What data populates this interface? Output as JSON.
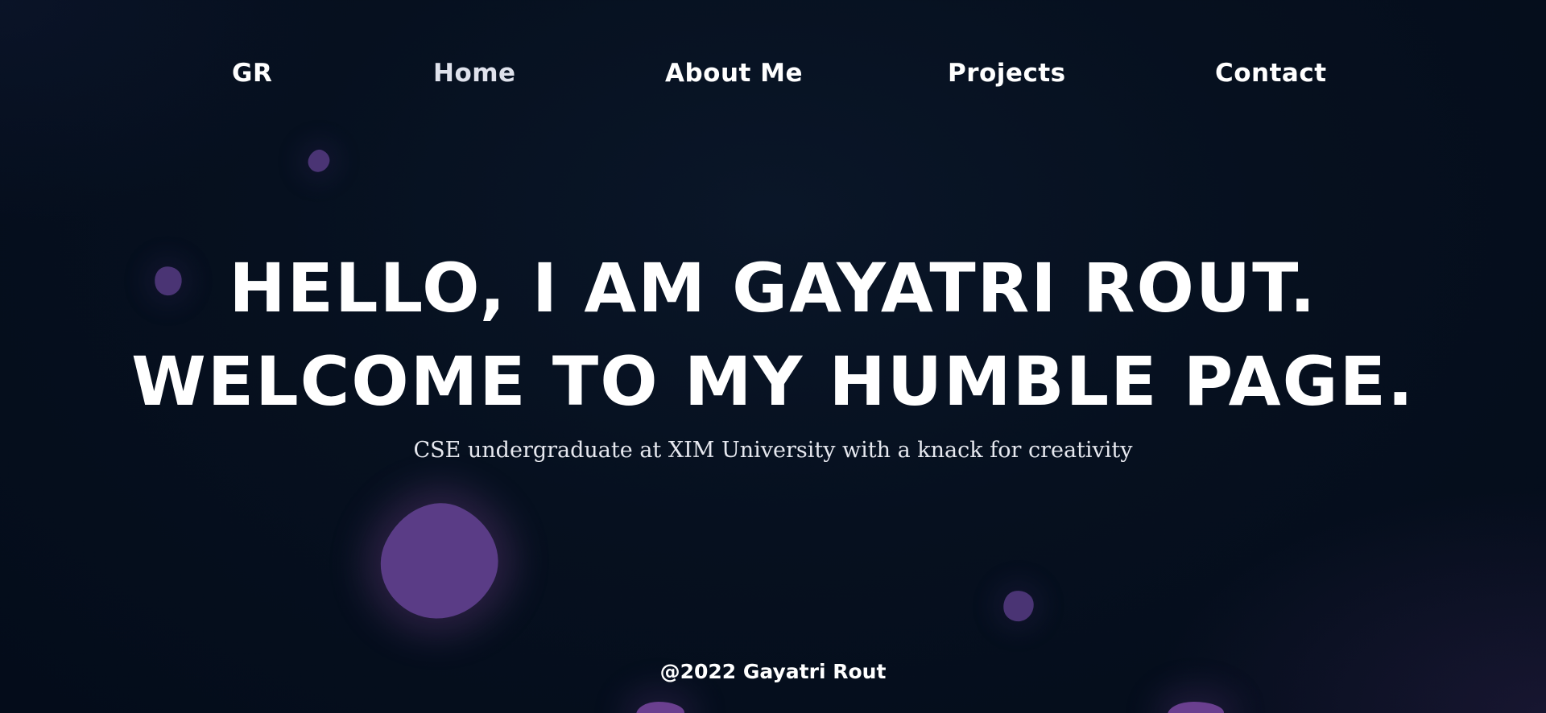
{
  "nav": {
    "logo": "GR",
    "items": [
      {
        "label": "Home"
      },
      {
        "label": "About Me"
      },
      {
        "label": "Projects"
      },
      {
        "label": "Contact"
      }
    ]
  },
  "hero": {
    "title_line_1": "HELLO, I AM GAYATRI ROUT.",
    "title_line_2": "WELCOME TO MY HUMBLE PAGE.",
    "subtitle": "CSE undergraduate at XIM University with a knack for creativity"
  },
  "footer": {
    "copyright": "@2022 Gayatri Rout"
  },
  "colors": {
    "background": "#06101f",
    "blob": "#5b3b86",
    "text": "#ffffff"
  }
}
